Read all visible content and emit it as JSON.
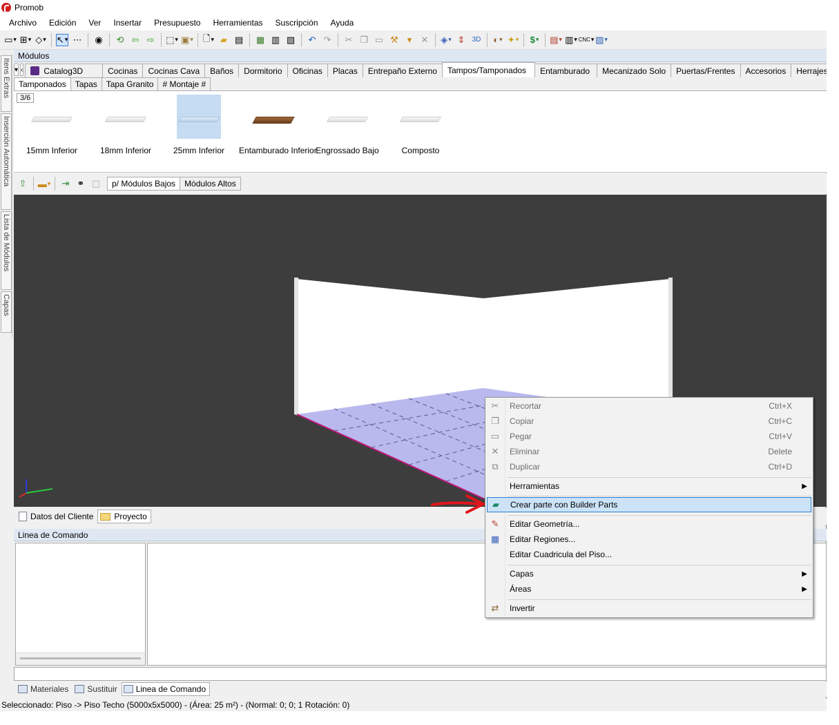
{
  "window": {
    "title": "Promob"
  },
  "menu": [
    "Archivo",
    "Edición",
    "Ver",
    "Insertar",
    "Presupuesto",
    "Herramientas",
    "Suscripción",
    "Ayuda"
  ],
  "left_strip": {
    "tabs": [
      "Itens Extras",
      "Inserción Automática",
      "Lista de Módulos",
      "Capas"
    ]
  },
  "modules_panel": {
    "title": "Módulos",
    "category_tabs": [
      "Catalog3D",
      "Cocinas",
      "Cocinas Cava",
      "Baños",
      "Dormitorio",
      "Oficinas",
      "Placas",
      "Entrepaño Externo",
      "Tampos/Tamponados",
      "Entamburado",
      "Mecanizado Solo",
      "Puertas/Frentes",
      "Accesorios",
      "Herrajes",
      "#"
    ],
    "active_category": "Tampos/Tamponados",
    "sub_tabs": [
      "Tamponados",
      "Tapas",
      "Tapa Granito",
      "# Montaje #"
    ],
    "page_indicator": "3/6",
    "items": [
      {
        "label": "15mm Inferior",
        "material": "white"
      },
      {
        "label": "18mm Inferior",
        "material": "white"
      },
      {
        "label": "25mm Inferior",
        "material": "white",
        "selected": true
      },
      {
        "label": "Entamburado Inferior",
        "material": "wood"
      },
      {
        "label": "Engrossado Bajo",
        "material": "white"
      },
      {
        "label": "Composto",
        "material": "white"
      }
    ]
  },
  "view_tabs": [
    "p/ Módulos Bajos",
    "Módulos Altos"
  ],
  "bottom_tabs": [
    "Datos del Cliente",
    "Proyecto"
  ],
  "command_panel": {
    "title": "Linea de Comando"
  },
  "dock_tabs": [
    "Materiales",
    "Sustituir",
    "Linea de Comando"
  ],
  "status": "Seleccionado: Piso -> Piso Techo (5000x5x5000) - (Área: 25 m²) - (Normal: 0; 0; 1 Rotación: 0)",
  "context_menu": {
    "items": [
      {
        "label": "Recortar",
        "shortcut": "Ctrl+X",
        "icon": "scissors-icon",
        "disabled": true
      },
      {
        "label": "Copiar",
        "shortcut": "Ctrl+C",
        "icon": "copy-icon",
        "disabled": true
      },
      {
        "label": "Pegar",
        "shortcut": "Ctrl+V",
        "icon": "paste-icon",
        "disabled": true
      },
      {
        "label": "Eliminar",
        "shortcut": "Delete",
        "icon": "delete-icon",
        "disabled": true
      },
      {
        "label": "Duplicar",
        "shortcut": "Ctrl+D",
        "icon": "duplicate-icon",
        "disabled": true
      },
      {
        "label": "Herramientas",
        "submenu": true
      },
      {
        "label": "Crear parte con Builder Parts",
        "icon": "builder-parts-icon",
        "highlighted": true
      },
      {
        "label": "Editar Geometría...",
        "icon": "edit-geometry-icon"
      },
      {
        "label": "Editar Regiones...",
        "icon": "edit-regions-icon"
      },
      {
        "label": "Editar Cuadricula del Piso..."
      },
      {
        "label": "Capas",
        "submenu": true
      },
      {
        "label": "Áreas",
        "submenu": true
      },
      {
        "label": "Invertir",
        "icon": "invert-icon"
      }
    ]
  },
  "colors": {
    "viewport_bg": "#3d3d3d",
    "floor": "#b9b9ee",
    "highlight": "#cce3f7",
    "annotation_arrow": "#e0151b"
  }
}
